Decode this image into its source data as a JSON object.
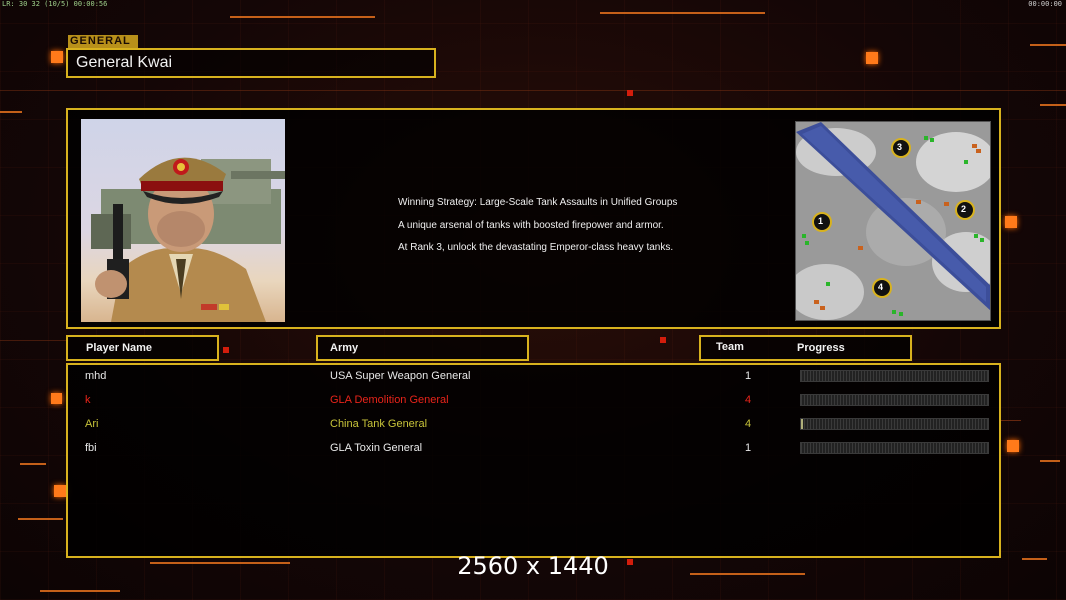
{
  "status_bar": {
    "left_text": "LR: 30 32 (10/5) 00:00:56",
    "right_text": "00:00:00"
  },
  "general": {
    "tag": "GENERAL",
    "name": "General Kwai",
    "strategy_lines": [
      "Winning Strategy: Large-Scale Tank Assaults in Unified Groups",
      "A unique arsenal of tanks with boosted firepower and armor.",
      "At Rank 3, unlock the devastating Emperor-class heavy tanks."
    ]
  },
  "minimap": {
    "start_positions": [
      "1",
      "2",
      "3",
      "4"
    ]
  },
  "columns": {
    "player_name": "Player Name",
    "army": "Army",
    "team": "Team",
    "progress": "Progress"
  },
  "players": [
    {
      "name": "mhd",
      "army": "USA Super Weapon General",
      "team": "1",
      "color": "#e8e8e8",
      "progress": 0
    },
    {
      "name": "k",
      "army": "GLA Demolition General",
      "team": "4",
      "color": "#e8241a",
      "progress": 0
    },
    {
      "name": "Ari",
      "army": "China Tank General",
      "team": "4",
      "color": "#c8c43a",
      "progress": 0.01
    },
    {
      "name": "fbi",
      "army": "GLA Toxin General",
      "team": "1",
      "color": "#e8e8e8",
      "progress": 0
    }
  ],
  "overlay_text": "2560 x 1440",
  "colors": {
    "accent_gold": "#d8b21e",
    "accent_orange": "#ff7a1a",
    "background": "#120707"
  }
}
